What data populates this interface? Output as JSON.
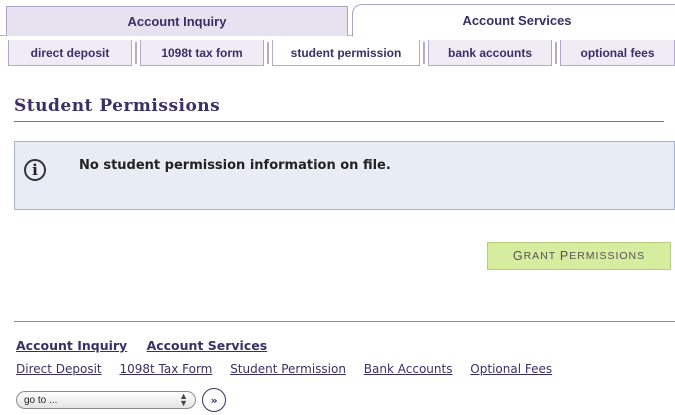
{
  "main_tabs": [
    {
      "label": "Account Inquiry",
      "active": false
    },
    {
      "label": "Account Services",
      "active": true
    }
  ],
  "sub_tabs": [
    {
      "label": "direct deposit"
    },
    {
      "label": "1098t tax form"
    },
    {
      "label": "student permission",
      "active": true
    },
    {
      "label": "bank accounts"
    },
    {
      "label": "optional fees"
    }
  ],
  "page": {
    "title": "Student Permissions",
    "info_icon": "info-circle-icon",
    "info_message": "No student permission information on file.",
    "grant_button": {
      "first": "G",
      "rest1": "RANT ",
      "second": "P",
      "rest2": "ERMISSIONS",
      "color": "#d6ec9e"
    }
  },
  "footer": {
    "nav": [
      "Account Inquiry",
      "Account Services"
    ],
    "links": [
      "Direct Deposit",
      "1098t Tax Form",
      "Student Permission",
      "Bank Accounts",
      "Optional Fees"
    ],
    "goto_value": "go to ...",
    "go_button": "»"
  },
  "colors": {
    "brand": "#3a2f66",
    "info_bg": "#e8edf5",
    "grant_bg": "#d6ec9e"
  }
}
